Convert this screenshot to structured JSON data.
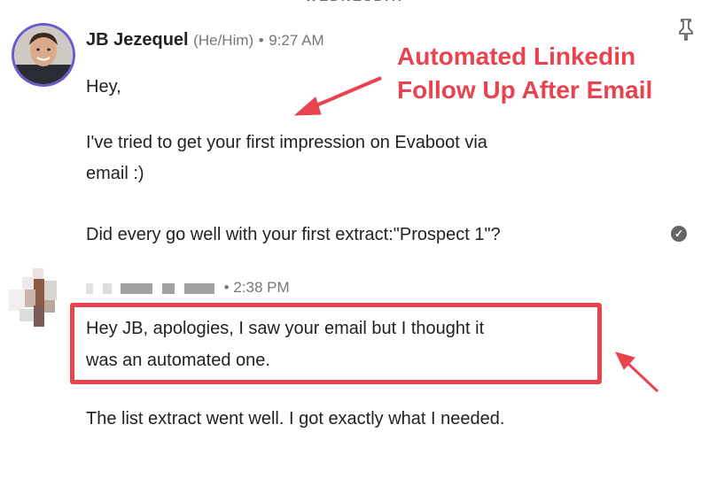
{
  "day_label": "WEDNESDAY",
  "message1": {
    "sender_name": "JB Jezequel",
    "pronouns": "(He/Him)",
    "separator": "•",
    "time": "9:27 AM",
    "lines": [
      "Hey,",
      "I've tried to get your first impression on Evaboot via",
      "email :)",
      "Did every go well with your first extract:\"Prospect 1\"?"
    ]
  },
  "message2": {
    "separator": "•",
    "time": "2:38 PM",
    "lines": [
      "Hey JB, apologies, I saw your email but I thought it",
      "was an automated one.",
      "The list extract went well. I got exactly what I needed."
    ]
  },
  "annotation": {
    "line1": "Automated Linkedin",
    "line2": "Follow Up After Email",
    "color": "#e8434f"
  },
  "icons": {
    "pin": "pin-icon",
    "read_receipt": "check-circle-icon"
  }
}
